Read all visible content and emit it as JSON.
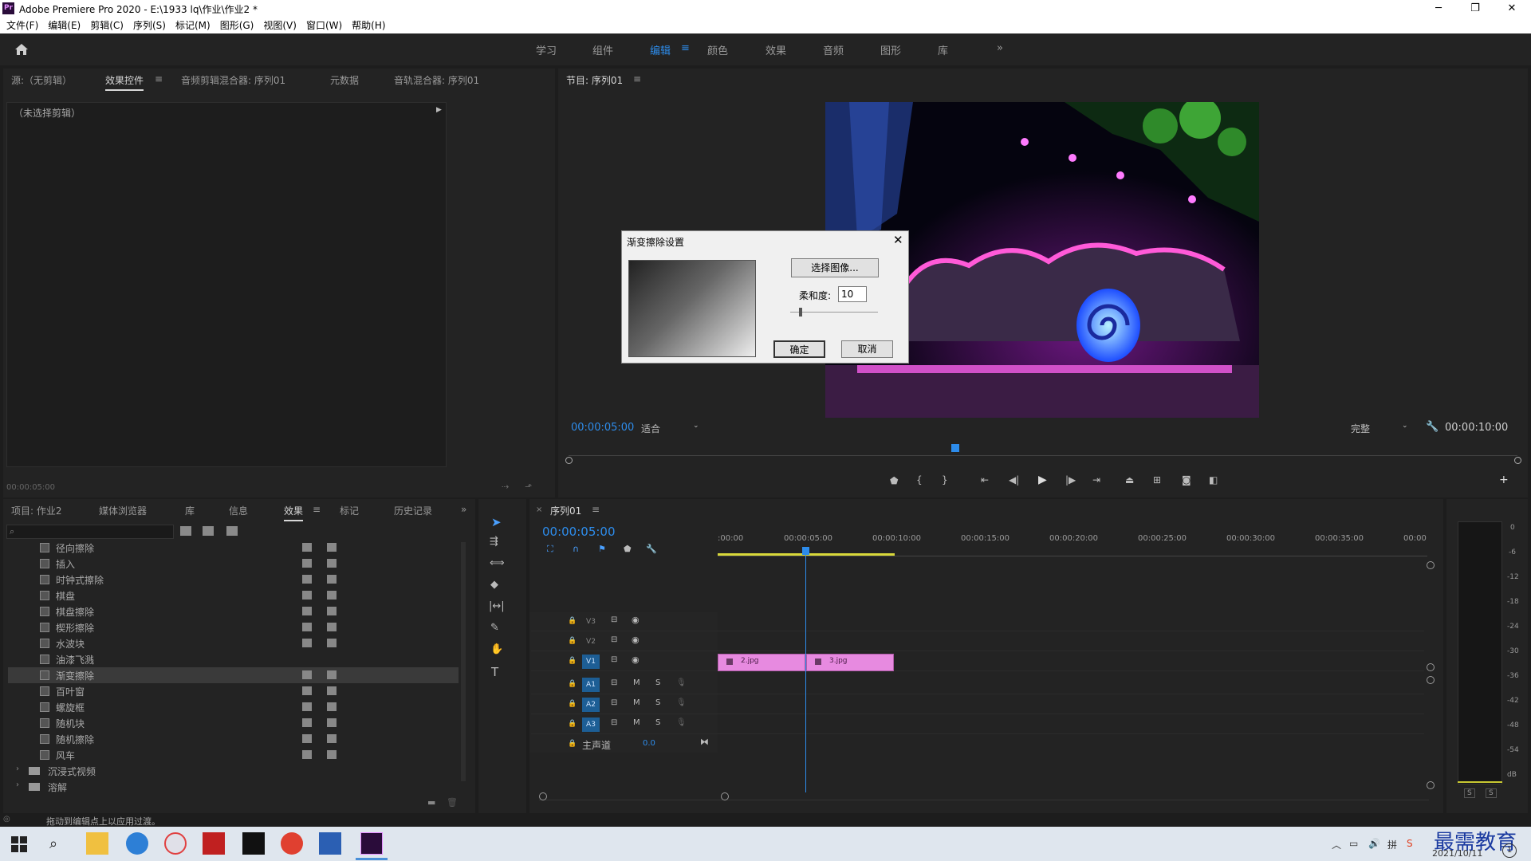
{
  "window": {
    "logo_text": "Pr",
    "title": "Adobe Premiere Pro 2020 - E:\\1933 lq\\作业\\作业2 *",
    "minimize": "─",
    "restore": "❐",
    "close": "✕"
  },
  "menu": [
    "文件(F)",
    "编辑(E)",
    "剪辑(C)",
    "序列(S)",
    "标记(M)",
    "图形(G)",
    "视图(V)",
    "窗口(W)",
    "帮助(H)"
  ],
  "workspaces": {
    "items": [
      "学习",
      "组件",
      "编辑",
      "颜色",
      "效果",
      "音频",
      "图形",
      "库"
    ],
    "active": "编辑",
    "more": "»"
  },
  "source_panel": {
    "tabs": [
      "源:（无剪辑）",
      "效果控件",
      "音频剪辑混合器: 序列01",
      "元数据",
      "音轨混合器: 序列01"
    ],
    "active_tab": "效果控件",
    "no_clip": "（未选择剪辑）",
    "timecode": "00:00:05:00"
  },
  "program_monitor": {
    "title": "节目: 序列01",
    "timecode": "00:00:05:00",
    "fit": "适合",
    "quality": "完整",
    "duration": "00:00:10:00"
  },
  "project_panel": {
    "tabs": [
      "项目: 作业2",
      "媒体浏览器",
      "库",
      "信息",
      "效果",
      "标记",
      "历史记录"
    ],
    "active_tab": "效果",
    "effects": [
      {
        "label": "径向擦除",
        "selected": false
      },
      {
        "label": "插入",
        "selected": false
      },
      {
        "label": "时钟式擦除",
        "selected": false
      },
      {
        "label": "棋盘",
        "selected": false
      },
      {
        "label": "棋盘擦除",
        "selected": false
      },
      {
        "label": "楔形擦除",
        "selected": false
      },
      {
        "label": "水波块",
        "selected": false
      },
      {
        "label": "油漆飞溅",
        "selected": false
      },
      {
        "label": "渐变擦除",
        "selected": true
      },
      {
        "label": "百叶窗",
        "selected": false
      },
      {
        "label": "螺旋框",
        "selected": false
      },
      {
        "label": "随机块",
        "selected": false
      },
      {
        "label": "随机擦除",
        "selected": false
      },
      {
        "label": "风车",
        "selected": false
      }
    ],
    "folders": [
      "沉浸式视频",
      "溶解"
    ]
  },
  "status_text": "拖动到编辑点上以应用过渡。",
  "timeline": {
    "sequence_tab": "序列01",
    "timecode": "00:00:05:00",
    "ruler": [
      ":00:00",
      "00:00:05:00",
      "00:00:10:00",
      "00:00:15:00",
      "00:00:20:00",
      "00:00:25:00",
      "00:00:30:00",
      "00:00:35:00",
      "00:00"
    ],
    "video_tracks": [
      "V3",
      "V2",
      "V1"
    ],
    "audio_tracks": [
      "A1",
      "A2",
      "A3"
    ],
    "master_label": "主声道",
    "master_value": "0.0",
    "clips": [
      "2.jpg",
      "3.jpg"
    ],
    "mute": "M",
    "solo": "S"
  },
  "audio_meter": {
    "scale": [
      "0",
      "-6",
      "-12",
      "-18",
      "-24",
      "-30",
      "-36",
      "-42",
      "-48",
      "-54",
      "dB"
    ],
    "solo_buttons": [
      "S",
      "S"
    ]
  },
  "dialog": {
    "title": "渐变擦除设置",
    "select_image": "选择图像...",
    "softness_label": "柔和度:",
    "softness_value": "10",
    "ok": "确定",
    "cancel": "取消"
  },
  "taskbar": {
    "date": "2021/10/11",
    "watermark": "最需教育"
  },
  "colors": {
    "accent": "#2d8ceb",
    "clip": "#e78ae0",
    "bg": "#232323"
  }
}
